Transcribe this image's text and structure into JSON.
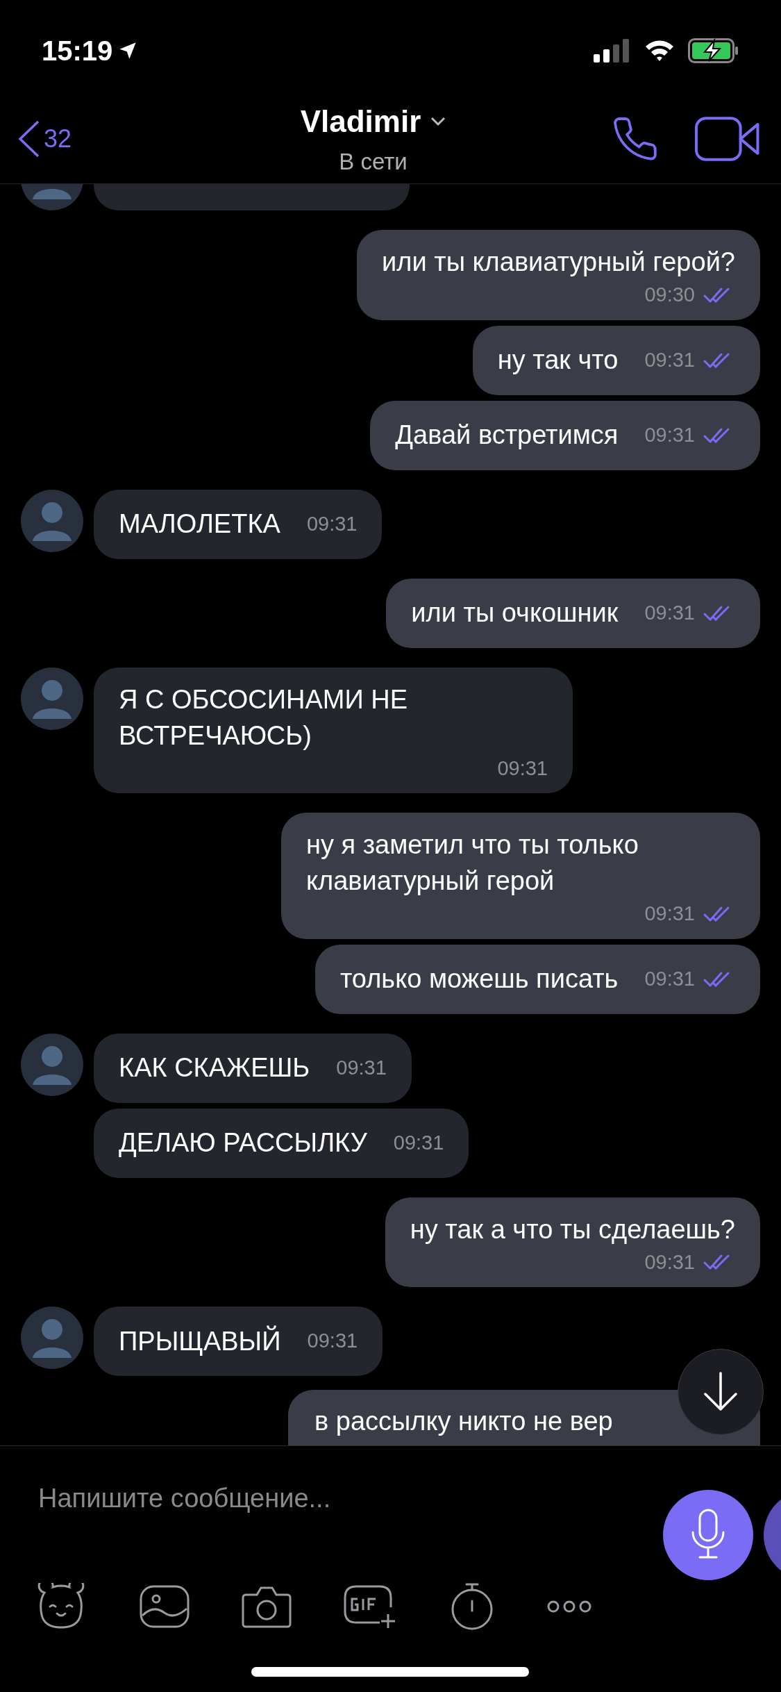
{
  "status_bar": {
    "time": "15:19"
  },
  "header": {
    "back_count": "32",
    "title": "Vladimir",
    "subtitle": "В сети"
  },
  "messages": [
    {
      "kind": "received_partial",
      "avatar": true
    },
    {
      "kind": "sent_long",
      "text": "или ты клавиатурный герой?",
      "time": "09:30",
      "read": true
    },
    {
      "kind": "sent",
      "text": "ну так что",
      "time": "09:31",
      "read": true
    },
    {
      "kind": "sent",
      "text": "Давай встретимся",
      "time": "09:31",
      "read": true
    },
    {
      "kind": "received",
      "avatar": true,
      "text": "МАЛОЛЕТКА",
      "time": "09:31"
    },
    {
      "kind": "sent",
      "text": "или ты очкошник",
      "time": "09:31",
      "read": true
    },
    {
      "kind": "received_long",
      "avatar": true,
      "text": "Я С ОБСОСИНАМИ НЕ ВСТРЕЧАЮСЬ)",
      "time": "09:31"
    },
    {
      "kind": "sent_long",
      "text": "ну я заметил что ты только клавиатурный герой",
      "time": "09:31",
      "read": true
    },
    {
      "kind": "sent",
      "text": "только можешь писать",
      "time": "09:31",
      "read": true
    },
    {
      "kind": "received",
      "avatar": true,
      "text": "КАК СКАЖЕШЬ",
      "time": "09:31"
    },
    {
      "kind": "received",
      "avatar": false,
      "text": "ДЕЛАЮ РАССЫЛКУ",
      "time": "09:31"
    },
    {
      "kind": "sent_long",
      "text": "ну так а что ты сделаешь?",
      "time": "09:31",
      "read": true
    },
    {
      "kind": "received",
      "avatar": true,
      "text": "ПРЫЩАВЫЙ",
      "time": "09:31"
    },
    {
      "kind": "sent_partial",
      "text": "в рассылку никто не вер"
    }
  ],
  "composer": {
    "placeholder": "Напишите сообщение..."
  }
}
